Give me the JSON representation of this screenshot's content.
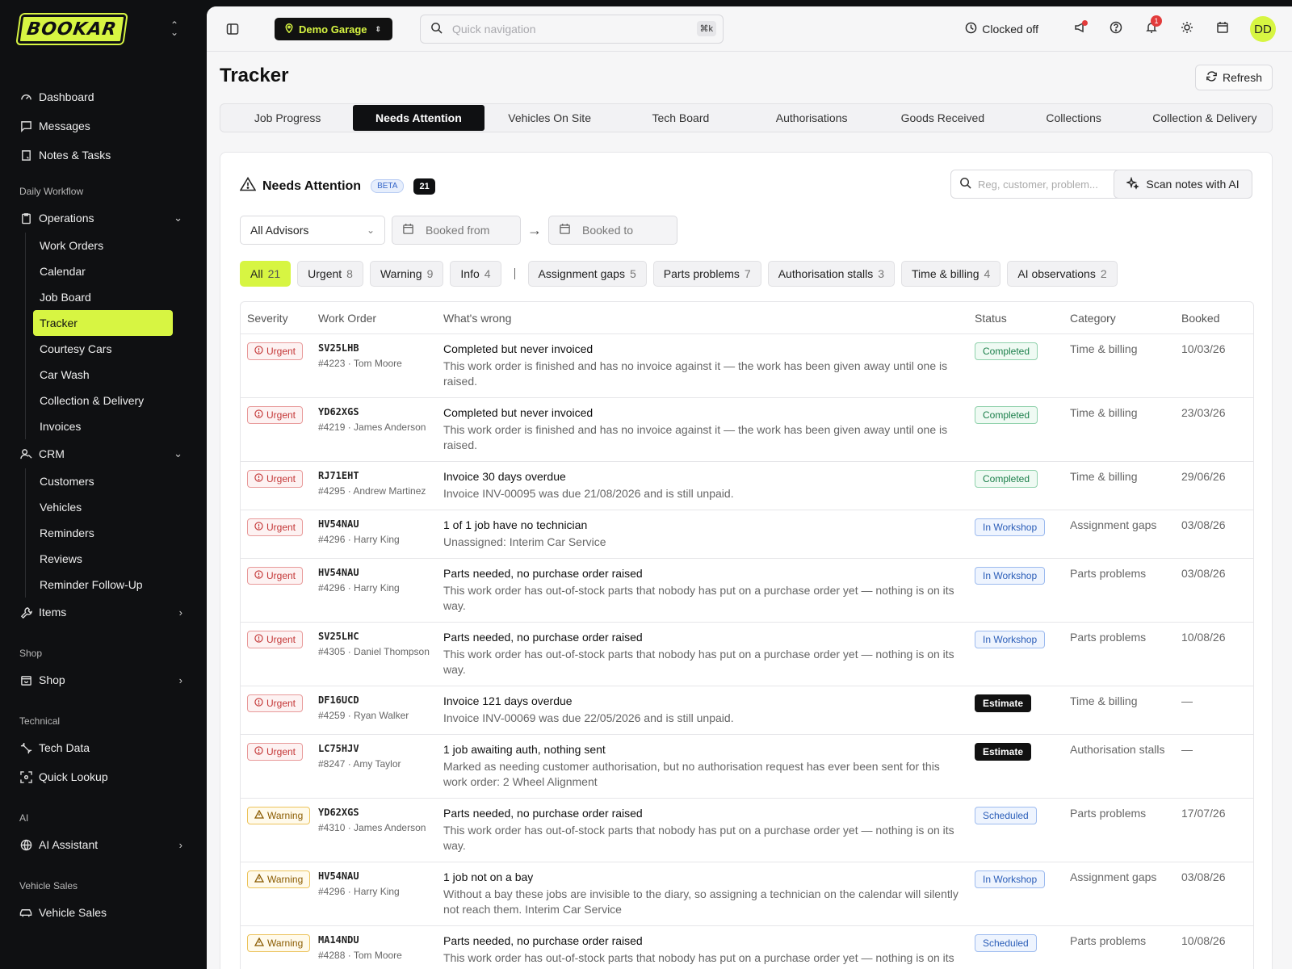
{
  "brand": {
    "logo_text": "BOOKAR",
    "accent": "#d7f542",
    "sidebar_bg": "#0f1012"
  },
  "sidebar": {
    "top": [
      {
        "label": "Dashboard",
        "icon": "gauge-icon"
      },
      {
        "label": "Messages",
        "icon": "message-icon"
      },
      {
        "label": "Notes & Tasks",
        "icon": "note-icon"
      }
    ],
    "daily_workflow": "Daily Workflow",
    "operations": {
      "label": "Operations",
      "items": [
        "Work Orders",
        "Calendar",
        "Job Board",
        "Tracker",
        "Courtesy Cars",
        "Car Wash",
        "Collection & Delivery",
        "Invoices"
      ],
      "active": "Tracker"
    },
    "crm": {
      "label": "CRM",
      "items": [
        "Customers",
        "Vehicles",
        "Reminders",
        "Reviews",
        "Reminder Follow-Up"
      ]
    },
    "items": "Items",
    "shop_section": "Shop",
    "shop": "Shop",
    "technical_section": "Technical",
    "tech_data": "Tech Data",
    "quick_lookup": "Quick Lookup",
    "ai_section": "AI",
    "ai_assistant": "AI Assistant",
    "vehicle_sales_section": "Vehicle Sales",
    "vehicle_sales": "Vehicle Sales"
  },
  "topbar": {
    "garage": "Demo Garage",
    "quick_nav_placeholder": "Quick navigation",
    "shortcut": "⌘k",
    "clock_status": "Clocked off",
    "notification_count": "1",
    "avatar": "DD"
  },
  "page": {
    "title": "Tracker",
    "refresh": "Refresh"
  },
  "tabs": [
    "Job Progress",
    "Needs Attention",
    "Vehicles On Site",
    "Tech Board",
    "Authorisations",
    "Goods Received",
    "Collections",
    "Collection & Delivery"
  ],
  "active_tab": "Needs Attention",
  "panel": {
    "title": "Needs Attention",
    "beta": "BETA",
    "count": "21",
    "search_placeholder": "Reg, customer, problem...",
    "scan_button": "Scan notes with AI"
  },
  "filters": {
    "advisors": "All Advisors",
    "booked_from": "Booked from",
    "booked_to": "Booked to"
  },
  "chips": [
    {
      "label": "All",
      "n": "21",
      "active": true
    },
    {
      "label": "Urgent",
      "n": "8"
    },
    {
      "label": "Warning",
      "n": "9"
    },
    {
      "label": "Info",
      "n": "4"
    },
    {
      "sep": true
    },
    {
      "label": "Assignment gaps",
      "n": "5"
    },
    {
      "label": "Parts problems",
      "n": "7"
    },
    {
      "label": "Authorisation stalls",
      "n": "3"
    },
    {
      "label": "Time & billing",
      "n": "4"
    },
    {
      "label": "AI observations",
      "n": "2"
    }
  ],
  "table": {
    "headers": [
      "Severity",
      "Work Order",
      "What's wrong",
      "Status",
      "Category",
      "Booked"
    ],
    "rows": [
      {
        "sev": "Urgent",
        "reg": "SV25LHB",
        "wo": "#4223 · Tom Moore",
        "title": "Completed but never invoiced",
        "desc": "This work order is finished and has no invoice against it — the work has been given away until one is raised.",
        "status": "Completed",
        "cat": "Time & billing",
        "booked": "10/03/26"
      },
      {
        "sev": "Urgent",
        "reg": "YD62XGS",
        "wo": "#4219 · James Anderson",
        "title": "Completed but never invoiced",
        "desc": "This work order is finished and has no invoice against it — the work has been given away until one is raised.",
        "status": "Completed",
        "cat": "Time & billing",
        "booked": "23/03/26"
      },
      {
        "sev": "Urgent",
        "reg": "RJ71EHT",
        "wo": "#4295 · Andrew Martinez",
        "title": "Invoice 30 days overdue",
        "desc": "Invoice INV-00095 was due 21/08/2026 and is still unpaid.",
        "status": "Completed",
        "cat": "Time & billing",
        "booked": "29/06/26"
      },
      {
        "sev": "Urgent",
        "reg": "HV54NAU",
        "wo": "#4296 · Harry King",
        "title": "1 of 1 job have no technician",
        "desc": "Unassigned: Interim Car Service",
        "status": "In Workshop",
        "cat": "Assignment gaps",
        "booked": "03/08/26"
      },
      {
        "sev": "Urgent",
        "reg": "HV54NAU",
        "wo": "#4296 · Harry King",
        "title": "Parts needed, no purchase order raised",
        "desc": "This work order has out-of-stock parts that nobody has put on a purchase order yet — nothing is on its way.",
        "status": "In Workshop",
        "cat": "Parts problems",
        "booked": "03/08/26"
      },
      {
        "sev": "Urgent",
        "reg": "SV25LHC",
        "wo": "#4305 · Daniel Thompson",
        "title": "Parts needed, no purchase order raised",
        "desc": "This work order has out-of-stock parts that nobody has put on a purchase order yet — nothing is on its way.",
        "status": "In Workshop",
        "cat": "Parts problems",
        "booked": "10/08/26"
      },
      {
        "sev": "Urgent",
        "reg": "DF16UCD",
        "wo": "#4259 · Ryan Walker",
        "title": "Invoice 121 days overdue",
        "desc": "Invoice INV-00069 was due 22/05/2026 and is still unpaid.",
        "status": "Estimate",
        "cat": "Time & billing",
        "booked": "—"
      },
      {
        "sev": "Urgent",
        "reg": "LC75HJV",
        "wo": "#8247 · Amy Taylor",
        "title": "1 job awaiting auth, nothing sent",
        "desc": "Marked as needing customer authorisation, but no authorisation request has ever been sent for this work order: 2 Wheel Alignment",
        "status": "Estimate",
        "cat": "Authorisation stalls",
        "booked": "—"
      },
      {
        "sev": "Warning",
        "reg": "YD62XGS",
        "wo": "#4310 · James Anderson",
        "title": "Parts needed, no purchase order raised",
        "desc": "This work order has out-of-stock parts that nobody has put on a purchase order yet — nothing is on its way.",
        "status": "Scheduled",
        "cat": "Parts problems",
        "booked": "17/07/26"
      },
      {
        "sev": "Warning",
        "reg": "HV54NAU",
        "wo": "#4296 · Harry King",
        "title": "1 job not on a bay",
        "desc": "Without a bay these jobs are invisible to the diary, so assigning a technician on the calendar will silently not reach them. Interim Car Service",
        "status": "In Workshop",
        "cat": "Assignment gaps",
        "booked": "03/08/26"
      },
      {
        "sev": "Warning",
        "reg": "MA14NDU",
        "wo": "#4288 · Tom Moore",
        "title": "Parts needed, no purchase order raised",
        "desc": "This work order has out-of-stock parts that nobody has put on a purchase order yet — nothing is on its way.",
        "status": "Scheduled",
        "cat": "Parts problems",
        "booked": "10/08/26"
      }
    ]
  }
}
